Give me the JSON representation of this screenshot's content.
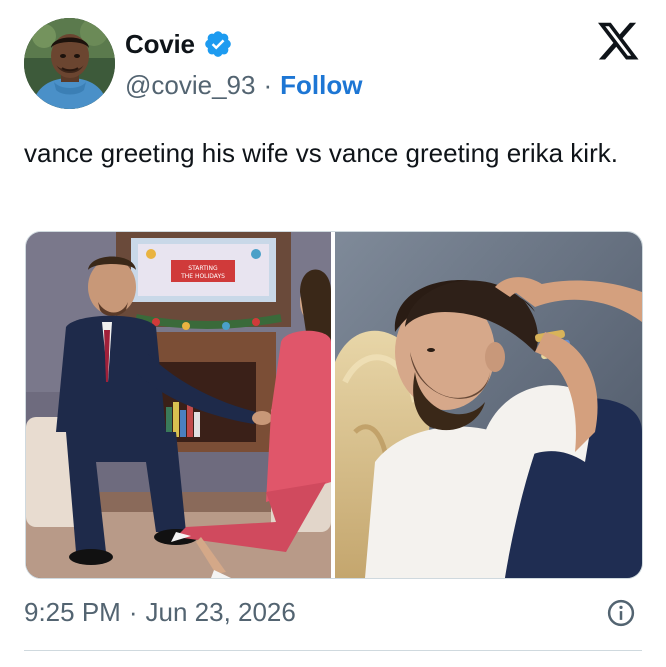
{
  "author": {
    "display_name": "Covie",
    "handle": "@covie_93",
    "separator": "·",
    "follow_label": "Follow",
    "verified": true,
    "avatar_icon": "avatar-photo"
  },
  "tweet": {
    "text": "vance greeting his wife vs vance greeting erika kirk.",
    "media": [
      {
        "icon": "photo-left",
        "sign_text": "STARTING\nTHE HOLIDAYS"
      },
      {
        "icon": "photo-right"
      }
    ]
  },
  "footer": {
    "time": "9:25 PM",
    "separator": "·",
    "date": "Jun 23, 2026"
  },
  "icons": {
    "brand": "x-logo-icon",
    "verified": "verified-badge-icon",
    "info": "info-icon"
  },
  "colors": {
    "text": "#0f1419",
    "secondary": "#536471",
    "follow": "#1d76d4",
    "verified": "#1d9bf0",
    "border": "#cfd9de"
  }
}
